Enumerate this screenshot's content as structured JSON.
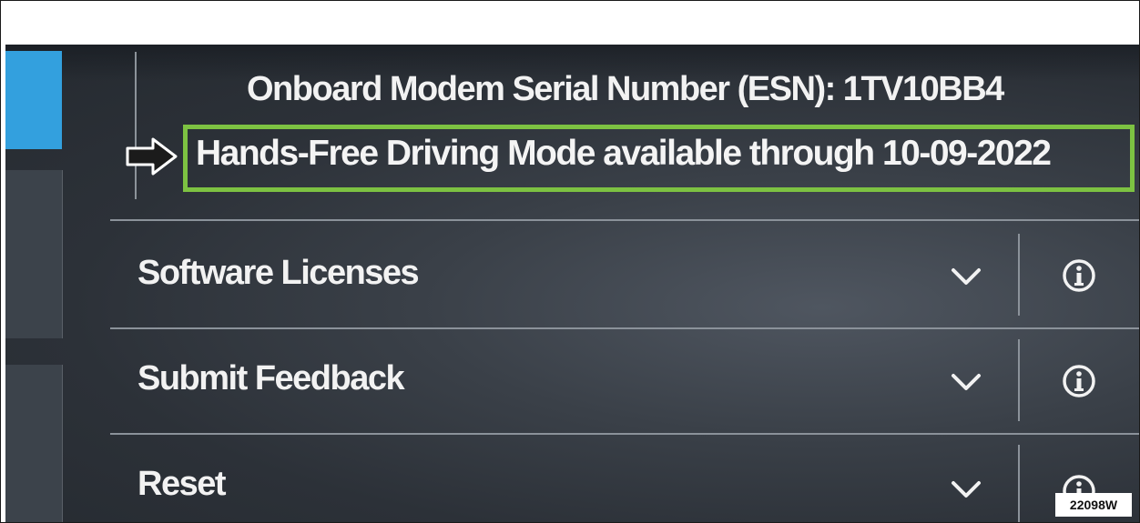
{
  "modem": {
    "esn_text": "Onboard Modem Serial Number (ESN): 1TV10BB4"
  },
  "hands_free": {
    "text": "Hands-Free Driving Mode available through 10-09-2022"
  },
  "menu": {
    "items": [
      {
        "label": "Software Licenses",
        "expand_icon": "chevron-down-icon",
        "info_icon": "info-icon"
      },
      {
        "label": "Submit Feedback",
        "expand_icon": "chevron-down-icon",
        "info_icon": "info-icon"
      },
      {
        "label": "Reset",
        "expand_icon": "chevron-down-icon",
        "info_icon": "info-icon"
      }
    ]
  },
  "figure": {
    "code": "22098W"
  },
  "colors": {
    "highlight": "#7dc242",
    "accent": "#33a0de",
    "text": "#f2f2f2",
    "background": "#2c3138"
  }
}
